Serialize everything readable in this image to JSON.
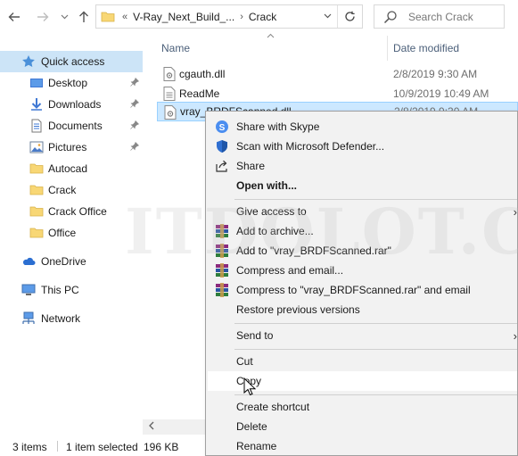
{
  "address": {
    "overflow_label": "«",
    "path": [
      "V-Ray_Next_Build_...",
      "Crack"
    ],
    "separator": "›",
    "dropdown_icon": "chevron-down-icon",
    "refresh_icon": "refresh-icon"
  },
  "search": {
    "placeholder": "Search Crack"
  },
  "nav": {
    "items": [
      {
        "label": "Quick access",
        "icon": "star-icon",
        "selected": true
      },
      {
        "label": "Desktop",
        "icon": "desktop-icon",
        "pinned": true
      },
      {
        "label": "Downloads",
        "icon": "download-icon",
        "pinned": true
      },
      {
        "label": "Documents",
        "icon": "documents-icon",
        "pinned": true
      },
      {
        "label": "Pictures",
        "icon": "pictures-icon",
        "pinned": true
      },
      {
        "label": "Autocad",
        "icon": "folder-icon"
      },
      {
        "label": "Crack",
        "icon": "folder-icon"
      },
      {
        "label": "Crack Office",
        "icon": "folder-icon"
      },
      {
        "label": "Office",
        "icon": "folder-icon"
      },
      {
        "label": "OneDrive",
        "icon": "cloud-icon"
      },
      {
        "label": "This PC",
        "icon": "computer-icon"
      },
      {
        "label": "Network",
        "icon": "network-icon"
      }
    ]
  },
  "columns": {
    "name": "Name",
    "date": "Date modified"
  },
  "files": [
    {
      "name": "cgauth.dll",
      "date": "2/8/2019 9:30 AM",
      "icon": "dll-file-icon"
    },
    {
      "name": "ReadMe",
      "date": "10/9/2019 10:49 AM",
      "icon": "text-file-icon"
    },
    {
      "name": "vray_BRDFScanned.dll",
      "date": "2/8/2019 9:30 AM",
      "icon": "dll-file-icon",
      "selected": true
    }
  ],
  "status": {
    "items": "3 items",
    "selection": "1 item selected",
    "size": "196 KB"
  },
  "context_menu": {
    "items": [
      {
        "label": "Share with Skype",
        "icon": "skype-icon"
      },
      {
        "label": "Scan with Microsoft Defender...",
        "icon": "defender-shield-icon"
      },
      {
        "label": "Share",
        "icon": "share-icon"
      },
      {
        "label": "Open with...",
        "bold": true
      },
      {
        "label": "Give access to",
        "submenu": true
      },
      {
        "label": "Add to archive...",
        "icon": "winrar-icon"
      },
      {
        "label": "Add to \"vray_BRDFScanned.rar\"",
        "icon": "winrar-icon"
      },
      {
        "label": "Compress and email...",
        "icon": "winrar-icon"
      },
      {
        "label": "Compress to \"vray_BRDFScanned.rar\" and email",
        "icon": "winrar-icon"
      },
      {
        "label": "Restore previous versions"
      },
      {
        "label": "Send to",
        "submenu": true
      },
      {
        "label": "Cut"
      },
      {
        "label": "Copy",
        "hover": true
      },
      {
        "label": "Create shortcut"
      },
      {
        "label": "Delete"
      },
      {
        "label": "Rename"
      }
    ],
    "submenu_arrow": "›"
  },
  "watermark": "ITDOLOT.COM"
}
